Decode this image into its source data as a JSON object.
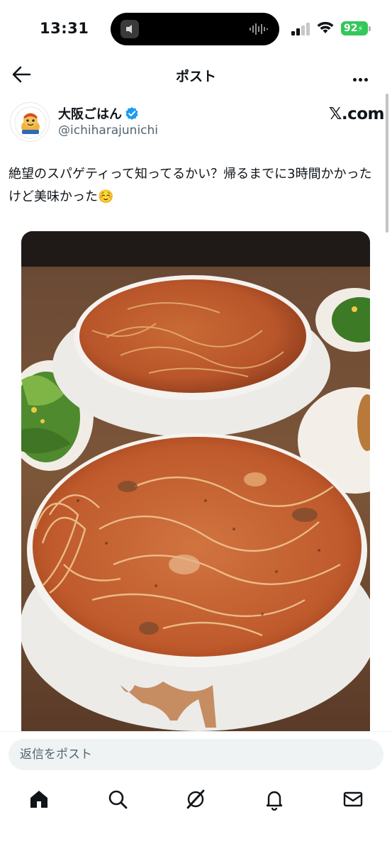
{
  "status_bar": {
    "time": "13:31",
    "battery": "92"
  },
  "header": {
    "title": "ポスト"
  },
  "author": {
    "display_name": "大阪ごはん",
    "handle": "@ichiharajunichi",
    "source_label": "𝕏.com"
  },
  "post": {
    "text": "絶望のスパゲティって知ってるかい？帰るまでに3時間かかったけど美味かった☺️"
  },
  "reply": {
    "placeholder": "返信をポスト"
  },
  "tabs": [
    {
      "icon": "home-icon"
    },
    {
      "icon": "search-icon"
    },
    {
      "icon": "grok-icon"
    },
    {
      "icon": "notifications-bell-icon"
    },
    {
      "icon": "messages-envelope-icon"
    }
  ],
  "colors": {
    "verified": "#1d9bf0",
    "battery": "#34c759",
    "muted_text": "#536471"
  }
}
